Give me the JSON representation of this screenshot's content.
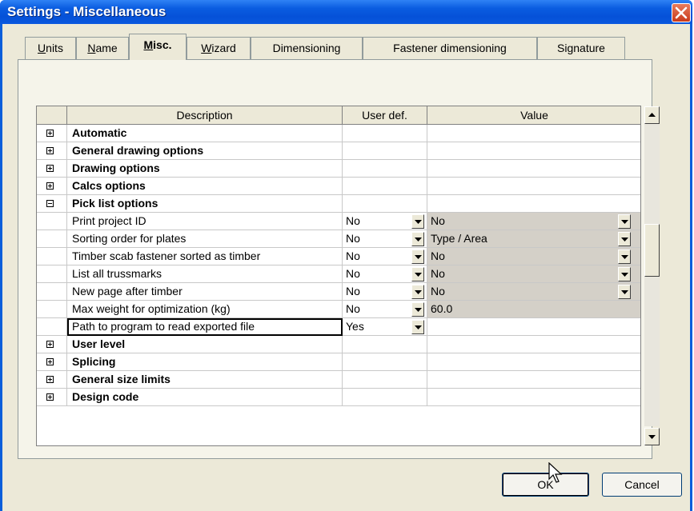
{
  "window": {
    "title": "Settings - Miscellaneous",
    "close_icon": "close-icon",
    "title_color": "#0a5ce0"
  },
  "tabs": [
    {
      "label_pre": "",
      "label_ul": "U",
      "label_post": "nits",
      "active": false
    },
    {
      "label_pre": "",
      "label_ul": "N",
      "label_post": "ame",
      "active": false
    },
    {
      "label_pre": "",
      "label_ul": "M",
      "label_post": "isc.",
      "active": true
    },
    {
      "label_pre": "",
      "label_ul": "W",
      "label_post": "izard",
      "active": false
    },
    {
      "label": "Dimensioning",
      "active": false
    },
    {
      "label": "Fastener dimensioning",
      "active": false
    },
    {
      "label": "Signature",
      "active": false
    }
  ],
  "grid": {
    "columns": [
      "Description",
      "User def.",
      "Value"
    ],
    "rows": [
      {
        "type": "group",
        "expander": "plus",
        "description": "Automatic"
      },
      {
        "type": "group",
        "expander": "plus",
        "description": "General drawing options"
      },
      {
        "type": "group",
        "expander": "plus",
        "description": "Drawing options"
      },
      {
        "type": "group",
        "expander": "plus",
        "description": "Calcs options"
      },
      {
        "type": "group",
        "expander": "minus",
        "description": "Pick list options"
      },
      {
        "type": "item",
        "description": "Print project ID",
        "user_def": "No",
        "value": "No",
        "value_dropdown": true
      },
      {
        "type": "item",
        "description": "Sorting order for plates",
        "user_def": "No",
        "value": "Type / Area",
        "value_dropdown": true
      },
      {
        "type": "item",
        "description": "Timber scab fastener sorted as timber",
        "user_def": "No",
        "value": "No",
        "value_dropdown": true
      },
      {
        "type": "item",
        "description": "List all trussmarks",
        "user_def": "No",
        "value": "No",
        "value_dropdown": true
      },
      {
        "type": "item",
        "description": "New page after timber",
        "user_def": "No",
        "value": "No",
        "value_dropdown": true
      },
      {
        "type": "item",
        "description": "Max weight for optimization (kg)",
        "user_def": "No",
        "value": "60.0",
        "value_dropdown": false
      },
      {
        "type": "item",
        "description": "Path to program to read exported file",
        "user_def": "Yes",
        "value": "",
        "value_dropdown": false,
        "focused": true,
        "value_gray": false
      },
      {
        "type": "group",
        "expander": "plus",
        "description": "User level"
      },
      {
        "type": "group",
        "expander": "plus",
        "description": "Splicing"
      },
      {
        "type": "group",
        "expander": "plus",
        "description": "General size limits"
      },
      {
        "type": "group",
        "expander": "plus",
        "description": "Design code"
      }
    ]
  },
  "buttons": {
    "ok": "OK",
    "cancel": "Cancel"
  }
}
